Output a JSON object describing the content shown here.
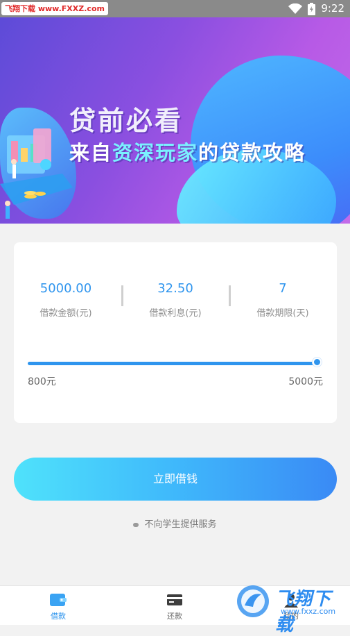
{
  "status_bar": {
    "watermark": "飞翔下载 www.FXXZ.com",
    "time": "9:22"
  },
  "banner": {
    "title": "贷前必看",
    "subtitle_pre": "来自",
    "subtitle_highlight": "资深玩家",
    "subtitle_post": "的贷款攻略"
  },
  "loan": {
    "amount_value": "5000.00",
    "amount_label": "借款金额(元)",
    "interest_value": "32.50",
    "interest_label": "借款利息(元)",
    "term_value": "7",
    "term_label": "借款期限(天)",
    "slider_min_label": "800元",
    "slider_max_label": "5000元",
    "slider_fraction": 1.0
  },
  "cta": {
    "label": "立即借钱"
  },
  "note": {
    "text": "不向学生提供服务"
  },
  "tabs": [
    {
      "label": "借款",
      "icon": "wallet-icon",
      "active": true
    },
    {
      "label": "还款",
      "icon": "card-icon",
      "active": false
    },
    {
      "label": "我的",
      "icon": "user-icon",
      "active": false
    }
  ],
  "watermark_bottom": {
    "title": "飞翔下载",
    "url": "www.fxxz.com"
  },
  "colors": {
    "accent": "#2f95ee",
    "banner_purple": "#8a4fe0",
    "cta_start": "#4fe2fb",
    "cta_end": "#3a8af5"
  }
}
